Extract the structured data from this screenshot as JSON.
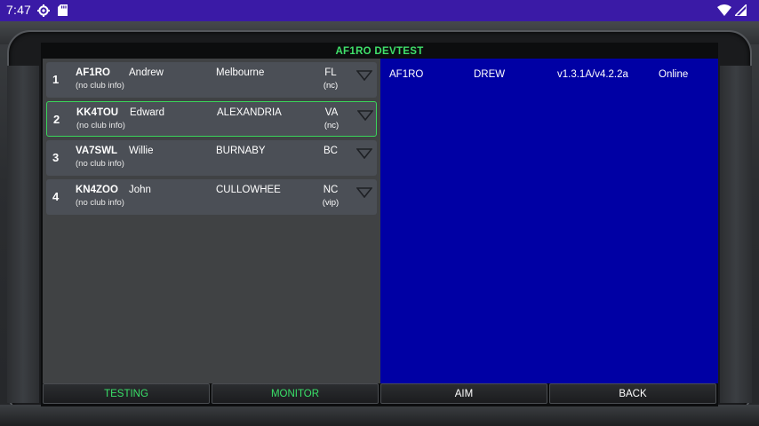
{
  "status_bar": {
    "time": "7:47",
    "icons": [
      "settings-gear-icon",
      "sd-card-icon",
      "wifi-icon",
      "cell-signal-icon"
    ]
  },
  "app": {
    "title": "AF1RO DEVTEST"
  },
  "stations": [
    {
      "index": "1",
      "call": "AF1RO",
      "club": "(no club info)",
      "name": "Andrew",
      "city": "Melbourne",
      "state": "FL",
      "tag": "(nc)",
      "selected": false
    },
    {
      "index": "2",
      "call": "KK4TOU",
      "club": "(no club info)",
      "name": "Edward",
      "city": "ALEXANDRIA",
      "state": "VA",
      "tag": "(nc)",
      "selected": true
    },
    {
      "index": "3",
      "call": "VA7SWL",
      "club": "(no club info)",
      "name": "Willie",
      "city": "BURNABY",
      "state": "BC",
      "tag": "",
      "selected": false
    },
    {
      "index": "4",
      "call": "KN4ZOO",
      "club": "(no club info)",
      "name": "John",
      "city": "CULLOWHEE",
      "state": "NC",
      "tag": "(vip)",
      "selected": false
    }
  ],
  "detail": {
    "call": "AF1RO",
    "name": "DREW",
    "version": "v1.3.1A/v4.2.2a",
    "status": "Online"
  },
  "buttons": {
    "testing": "TESTING",
    "monitor": "MONITOR",
    "aim": "AIM",
    "back": "BACK"
  },
  "colors": {
    "accent_green": "#39e068",
    "detail_blue": "#0000a4",
    "status_bar": "#3a1aa6",
    "row_bg": "#4b4f56"
  }
}
